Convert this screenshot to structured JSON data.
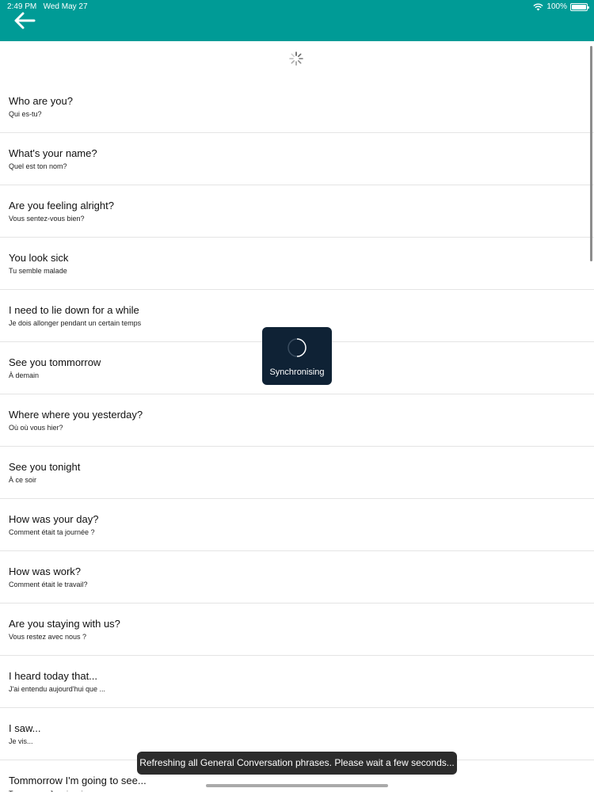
{
  "status_bar": {
    "time": "2:49 PM",
    "date": "Wed May 27",
    "battery": "100%",
    "battery_level": 1.0
  },
  "header": {
    "back_icon": "arrow-left-icon",
    "color": "#009b96"
  },
  "phrases": [
    {
      "en": "Who are you?",
      "fr": "Qui es-tu?"
    },
    {
      "en": "What's your name?",
      "fr": "Quel est ton nom?"
    },
    {
      "en": "Are you feeling alright?",
      "fr": "Vous sentez-vous bien?"
    },
    {
      "en": "You look sick",
      "fr": "Tu semble malade"
    },
    {
      "en": "I need to lie down for a while",
      "fr": "Je dois allonger pendant un certain temps"
    },
    {
      "en": "See you tommorrow",
      "fr": "À demain"
    },
    {
      "en": "Where where you yesterday?",
      "fr": "Où où vous hier?"
    },
    {
      "en": "See you tonight",
      "fr": "À ce soir"
    },
    {
      "en": "How was your day?",
      "fr": "Comment était ta journée ?"
    },
    {
      "en": "How was work?",
      "fr": "Comment était le travail?"
    },
    {
      "en": "Are you staying with us?",
      "fr": "Vous restez avec nous ?"
    },
    {
      "en": "I heard today that...",
      "fr": "J'ai entendu aujourd'hui que ..."
    },
    {
      "en": "I saw...",
      "fr": "Je vis..."
    },
    {
      "en": "Tommorrow I'm going to see...",
      "fr": "Tommorrow, Je vais voir..."
    }
  ],
  "sync_overlay": {
    "label": "Synchronising",
    "background": "#0f2235"
  },
  "toast": {
    "message": "Refreshing all General Conversation phrases. Please wait a few seconds..."
  }
}
